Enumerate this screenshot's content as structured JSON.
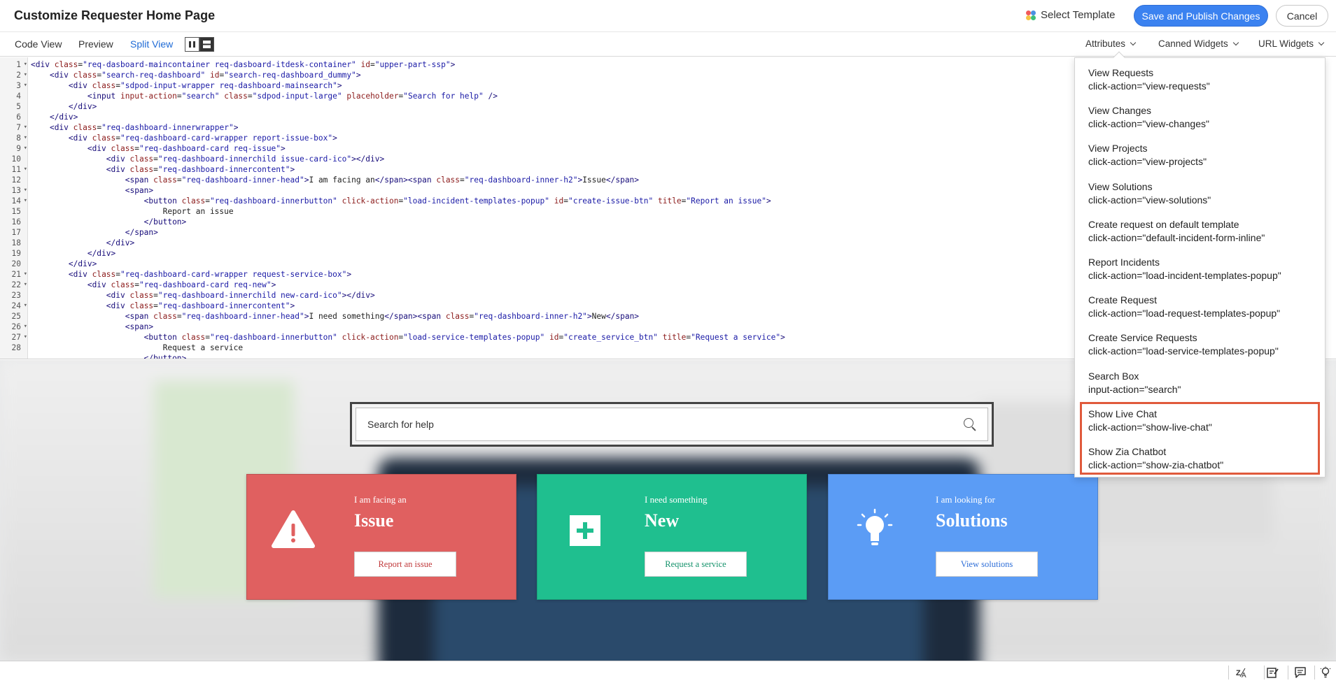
{
  "header": {
    "title": "Customize Requester Home Page",
    "select_template": "Select Template",
    "save_publish": "Save and Publish Changes",
    "cancel": "Cancel"
  },
  "toolbar": {
    "tabs": [
      "Code View",
      "Preview",
      "Split View"
    ],
    "active_tab": "Split View",
    "dropdowns": [
      "Attributes",
      "Canned Widgets",
      "URL Widgets"
    ]
  },
  "code_lines": [
    {
      "n": "1",
      "fold": true,
      "html": "<span class=\"tag\">&lt;div</span> <span class=\"attr\">class</span>=<span class=\"str\">\"req-dasboard-maincontainer req-dasboard-itdesk-container\"</span> <span class=\"attr\">id</span>=<span class=\"str\">\"upper-part-ssp\"</span><span class=\"tag\">&gt;</span>"
    },
    {
      "n": "2",
      "fold": true,
      "html": "    <span class=\"tag\">&lt;div</span> <span class=\"attr\">class</span>=<span class=\"str\">\"search-req-dashboard\"</span> <span class=\"attr\">id</span>=<span class=\"str\">\"search-req-dashboard_dummy\"</span><span class=\"tag\">&gt;</span>"
    },
    {
      "n": "3",
      "fold": true,
      "html": "        <span class=\"tag\">&lt;div</span> <span class=\"attr\">class</span>=<span class=\"str\">\"sdpod-input-wrapper req-dashboard-mainsearch\"</span><span class=\"tag\">&gt;</span>"
    },
    {
      "n": "4",
      "fold": false,
      "html": "            <span class=\"tag\">&lt;input</span> <span class=\"attr\">input-action</span>=<span class=\"str\">\"search\"</span> <span class=\"attr\">class</span>=<span class=\"str\">\"sdpod-input-large\"</span> <span class=\"attr\">placeholder</span>=<span class=\"str\">\"Search for help\"</span> <span class=\"tag\">/&gt;</span>"
    },
    {
      "n": "5",
      "fold": false,
      "html": "        <span class=\"tag\">&lt;/div&gt;</span>"
    },
    {
      "n": "6",
      "fold": false,
      "html": "    <span class=\"tag\">&lt;/div&gt;</span>"
    },
    {
      "n": "7",
      "fold": true,
      "html": "    <span class=\"tag\">&lt;div</span> <span class=\"attr\">class</span>=<span class=\"str\">\"req-dashboard-innerwrapper\"</span><span class=\"tag\">&gt;</span>"
    },
    {
      "n": "8",
      "fold": true,
      "html": "        <span class=\"tag\">&lt;div</span> <span class=\"attr\">class</span>=<span class=\"str\">\"req-dashboard-card-wrapper report-issue-box\"</span><span class=\"tag\">&gt;</span>"
    },
    {
      "n": "9",
      "fold": true,
      "html": "            <span class=\"tag\">&lt;div</span> <span class=\"attr\">class</span>=<span class=\"str\">\"req-dashboard-card req-issue\"</span><span class=\"tag\">&gt;</span>"
    },
    {
      "n": "10",
      "fold": false,
      "html": "                <span class=\"tag\">&lt;div</span> <span class=\"attr\">class</span>=<span class=\"str\">\"req-dashboard-innerchild issue-card-ico\"</span><span class=\"tag\">&gt;&lt;/div&gt;</span>"
    },
    {
      "n": "11",
      "fold": true,
      "html": "                <span class=\"tag\">&lt;div</span> <span class=\"attr\">class</span>=<span class=\"str\">\"req-dashboard-innercontent\"</span><span class=\"tag\">&gt;</span>"
    },
    {
      "n": "12",
      "fold": false,
      "html": "                    <span class=\"tag\">&lt;span</span> <span class=\"attr\">class</span>=<span class=\"str\">\"req-dashboard-inner-head\"</span><span class=\"tag\">&gt;</span>I am facing an<span class=\"tag\">&lt;/span&gt;&lt;span</span> <span class=\"attr\">class</span>=<span class=\"str\">\"req-dashboard-inner-h2\"</span><span class=\"tag\">&gt;</span>Issue<span class=\"tag\">&lt;/span&gt;</span>"
    },
    {
      "n": "13",
      "fold": true,
      "html": "                    <span class=\"tag\">&lt;span&gt;</span>"
    },
    {
      "n": "14",
      "fold": true,
      "html": "                        <span class=\"tag\">&lt;button</span> <span class=\"attr\">class</span>=<span class=\"str\">\"req-dashboard-innerbutton\"</span> <span class=\"attr\">click-action</span>=<span class=\"str\">\"load-incident-templates-popup\"</span> <span class=\"attr\">id</span>=<span class=\"str\">\"create-issue-btn\"</span> <span class=\"attr\">title</span>=<span class=\"str\">\"Report an issue\"</span><span class=\"tag\">&gt;</span>"
    },
    {
      "n": "15",
      "fold": false,
      "html": "                            Report an issue"
    },
    {
      "n": "16",
      "fold": false,
      "html": "                        <span class=\"tag\">&lt;/button&gt;</span>"
    },
    {
      "n": "17",
      "fold": false,
      "html": "                    <span class=\"tag\">&lt;/span&gt;</span>"
    },
    {
      "n": "18",
      "fold": false,
      "html": "                <span class=\"tag\">&lt;/div&gt;</span>"
    },
    {
      "n": "19",
      "fold": false,
      "html": "            <span class=\"tag\">&lt;/div&gt;</span>"
    },
    {
      "n": "20",
      "fold": false,
      "html": "        <span class=\"tag\">&lt;/div&gt;</span>"
    },
    {
      "n": "21",
      "fold": true,
      "html": "        <span class=\"tag\">&lt;div</span> <span class=\"attr\">class</span>=<span class=\"str\">\"req-dashboard-card-wrapper request-service-box\"</span><span class=\"tag\">&gt;</span>"
    },
    {
      "n": "22",
      "fold": true,
      "html": "            <span class=\"tag\">&lt;div</span> <span class=\"attr\">class</span>=<span class=\"str\">\"req-dashboard-card req-new\"</span><span class=\"tag\">&gt;</span>"
    },
    {
      "n": "23",
      "fold": false,
      "html": "                <span class=\"tag\">&lt;div</span> <span class=\"attr\">class</span>=<span class=\"str\">\"req-dashboard-innerchild new-card-ico\"</span><span class=\"tag\">&gt;&lt;/div&gt;</span>"
    },
    {
      "n": "24",
      "fold": true,
      "html": "                <span class=\"tag\">&lt;div</span> <span class=\"attr\">class</span>=<span class=\"str\">\"req-dashboard-innercontent\"</span><span class=\"tag\">&gt;</span>"
    },
    {
      "n": "25",
      "fold": false,
      "html": "                    <span class=\"tag\">&lt;span</span> <span class=\"attr\">class</span>=<span class=\"str\">\"req-dashboard-inner-head\"</span><span class=\"tag\">&gt;</span>I need something<span class=\"tag\">&lt;/span&gt;&lt;span</span> <span class=\"attr\">class</span>=<span class=\"str\">\"req-dashboard-inner-h2\"</span><span class=\"tag\">&gt;</span>New<span class=\"tag\">&lt;/span&gt;</span>"
    },
    {
      "n": "26",
      "fold": true,
      "html": "                    <span class=\"tag\">&lt;span&gt;</span>"
    },
    {
      "n": "27",
      "fold": true,
      "html": "                        <span class=\"tag\">&lt;button</span> <span class=\"attr\">class</span>=<span class=\"str\">\"req-dashboard-innerbutton\"</span> <span class=\"attr\">click-action</span>=<span class=\"str\">\"load-service-templates-popup\"</span> <span class=\"attr\">id</span>=<span class=\"str\">\"create_service_btn\"</span> <span class=\"attr\">title</span>=<span class=\"str\">\"Request a service\"</span><span class=\"tag\">&gt;</span>"
    },
    {
      "n": "28",
      "fold": false,
      "html": "                            Request a service"
    },
    {
      "n": "",
      "fold": false,
      "html": "                        <span class=\"tag\">&lt;/button&gt;</span>"
    }
  ],
  "preview": {
    "search_placeholder": "Search for help",
    "cards": [
      {
        "sub": "I am facing an",
        "head": "Issue",
        "button": "Report an issue",
        "color": "#e06060",
        "button_color": "#c0393b",
        "icon": "warning-icon"
      },
      {
        "sub": "I need something",
        "head": "New",
        "button": "Request a service",
        "color": "#1fbf8f",
        "button_color": "#16936c",
        "icon": "plus-icon"
      },
      {
        "sub": "I am looking for",
        "head": "Solutions",
        "button": "View solutions",
        "color": "#5b9cf5",
        "button_color": "#2f6fd8",
        "icon": "lightbulb-icon"
      }
    ]
  },
  "attributes_menu": [
    {
      "name": "View Requests",
      "value": "click-action=\"view-requests\""
    },
    {
      "name": "View Changes",
      "value": "click-action=\"view-changes\""
    },
    {
      "name": "View Projects",
      "value": "click-action=\"view-projects\""
    },
    {
      "name": "View Solutions",
      "value": "click-action=\"view-solutions\""
    },
    {
      "name": "Create request on default template",
      "value": "click-action=\"default-incident-form-inline\""
    },
    {
      "name": "Report Incidents",
      "value": "click-action=\"load-incident-templates-popup\""
    },
    {
      "name": "Create Request",
      "value": "click-action=\"load-request-templates-popup\""
    },
    {
      "name": "Create Service Requests",
      "value": "click-action=\"load-service-templates-popup\""
    },
    {
      "name": "Search Box",
      "value": "input-action=\"search\""
    },
    {
      "name": "Show Live Chat",
      "value": "click-action=\"show-live-chat\""
    },
    {
      "name": "Show Zia Chatbot",
      "value": "click-action=\"show-zia-chatbot\""
    }
  ],
  "colors": {
    "accent": "#3b82f0",
    "highlight": "#e05a3c"
  }
}
